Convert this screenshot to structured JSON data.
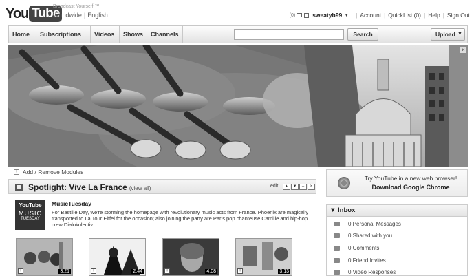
{
  "header": {
    "logo_you": "You",
    "logo_tube": "Tube",
    "tagline": "Broadcast Yourself ™",
    "locale_region": "Worldwide",
    "locale_language": "English",
    "mail_count": "(0)",
    "username": "sweatyb99",
    "links": [
      "Account",
      "QuickList (0)",
      "Help",
      "Sign Out"
    ]
  },
  "nav": {
    "tabs": [
      "Home",
      "Subscriptions",
      "Videos",
      "Shows",
      "Channels"
    ],
    "search_value": "",
    "search_button": "Search",
    "upload_button": "Upload"
  },
  "banner": {
    "close": "×"
  },
  "modules": {
    "add_remove_label": "Add / Remove Modules"
  },
  "spotlight": {
    "title": "Spotlight: Vive La France",
    "view_all": "(view all)",
    "edit": "edit",
    "channel_name": "MusicTuesday",
    "channel_logo_lines": [
      "YouTube",
      "MUSIC",
      "TUESDAY"
    ],
    "description": "For Bastille Day, we're storming the homepage with revolutionary music acts from France. Phoenix are magically transported to La Tour Eiffel for the occasion; also joining the party are Paris pop chanteuse Camille and hip-hop crew Dialokolectiv.",
    "videos": [
      {
        "duration": "3:21"
      },
      {
        "duration": "2:44"
      },
      {
        "duration": "4:08"
      },
      {
        "duration": "3:13"
      }
    ]
  },
  "chrome_promo": {
    "line1": "Try YouTube in a new web browser!",
    "line2": "Download Google Chrome"
  },
  "inbox": {
    "title": "Inbox",
    "items": [
      "0 Personal Messages",
      "0 Shared with you",
      "0 Comments",
      "0 Friend Invites",
      "0 Video Responses"
    ]
  }
}
